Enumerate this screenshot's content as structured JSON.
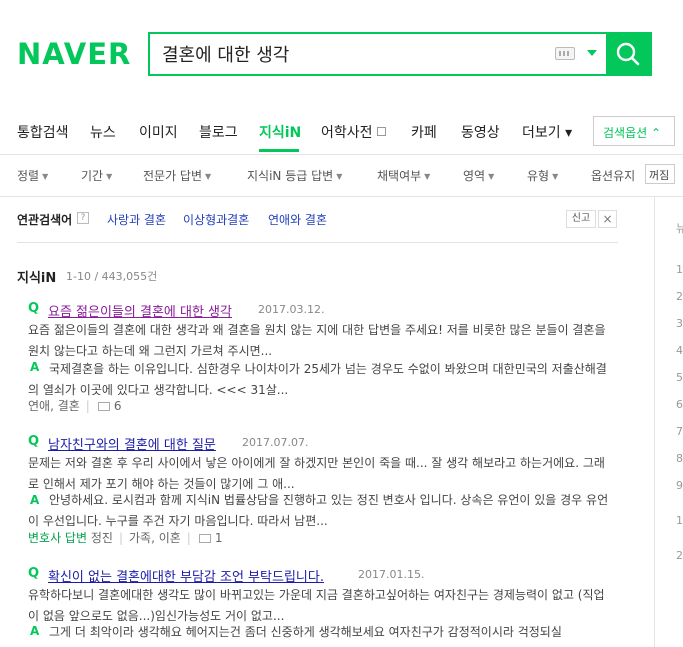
{
  "header": {
    "logo": "NAVER",
    "search_value": "결혼에 대한 생각"
  },
  "tabs": [
    {
      "label": "통합검색"
    },
    {
      "label": "뉴스"
    },
    {
      "label": "이미지"
    },
    {
      "label": "블로그"
    },
    {
      "label": "지식iN"
    },
    {
      "label": "어학사전"
    },
    {
      "label": "카페"
    },
    {
      "label": "동영상"
    },
    {
      "label": "더보기 ▾"
    }
  ],
  "search_options": "검색옵션 ⌃",
  "filters": [
    {
      "label": "정렬"
    },
    {
      "label": "기간"
    },
    {
      "label": "전문가 답변"
    },
    {
      "label": "지식iN 등급 답변"
    },
    {
      "label": "채택여부"
    },
    {
      "label": "영역"
    },
    {
      "label": "유형"
    },
    {
      "label": "옵션유지"
    }
  ],
  "filter_toggle": "꺼짐",
  "related": {
    "label": "연관검색어",
    "help": "?",
    "links": [
      "사랑과 결혼",
      "이상형과결혼",
      "연애와 결혼"
    ],
    "report": "신고",
    "close": "×"
  },
  "section": {
    "title": "지식iN",
    "count": "1-10 / 443,055건"
  },
  "results": [
    {
      "title": "요즘 젊은이들의 결혼에 대한 생각",
      "date": "2017.03.12.",
      "desc": "요즘 젊은이들의 결혼에 대한 생각과 왜 결혼을 원치 않는 지에 대한 답변을 주세요! 저를 비롯한 많은 분들이 결혼을 원치 않는다고 하는데 왜 그런지 가르쳐 주시면...",
      "answer": "국제결혼을 하는 이유입니다. 심한경우 나이차이가 25세가 넘는 경우도 수없이 봐왔으며 대한민국의 저출산해결의 열쇠가 이곳에 있다고 생각합니다. <<< 31살...",
      "meta_tags": "연애, 결혼",
      "comments": "6"
    },
    {
      "title": "남자친구와의 결혼에 대한 질문",
      "date": "2017.07.07.",
      "desc": "문제는 저와 결혼 후 우리 사이에서 낳은 아이에게 잘 하겠지만 본인이 죽을 때... 잘 생각 해보라고 하는거에요. 그래로 인해서 제가 포기 해야 하는 것들이 많기에 그 애...",
      "answer": "안녕하세요. 로시컴과 함께 지식iN 법률상담을 진행하고 있는 정진 변호사 입니다. 상속은 유언이 있을 경우 유언이 우선입니다. 누구를 주건 자기 마음입니다. 따라서 남편...",
      "meta_badge": "변호사 답변",
      "meta_name": "정진",
      "meta_tags": "가족, 이혼",
      "comments": "1"
    },
    {
      "title": "확신이 없는 결혼에대한 부담감 조언 부탁드립니다.",
      "date": "2017.01.15.",
      "desc": "유학하다보니 결혼에대한 생각도 많이 바뀌고있는 가운데 지금 결혼하고싶어하는 여자친구는 경제능력이 없고 (직업이 없음 앞으로도 없음...)임신가능성도 거이 없고...",
      "answer": "그게 더 최악이라 생각해요 헤어지는건 좀더 신중하게 생각해보세요 여자친구가 감정적이시라 걱정되실"
    }
  ],
  "right_panel": [
    "뉴",
    "1",
    "2",
    "3",
    "4",
    "5",
    "6",
    "7",
    "8",
    "9",
    "1",
    "2"
  ],
  "colors": {
    "brand": "#03c75a",
    "link": "#1b1baa",
    "visited": "#8a1c9a",
    "related": "#2340ba"
  }
}
